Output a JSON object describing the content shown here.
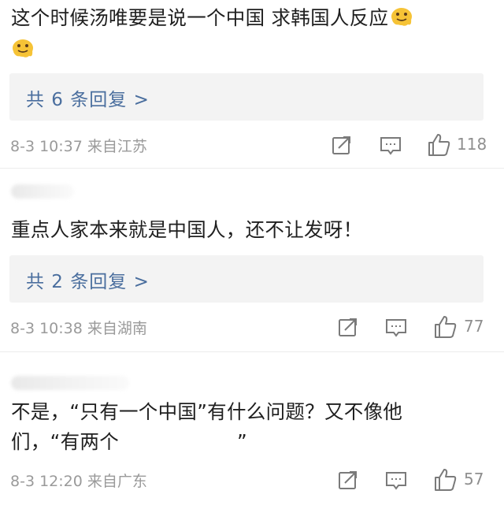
{
  "comments": [
    {
      "text": "这个时候汤唯要是说一个中国 求韩国人反应",
      "emoji_icon": "melting-face-emoji",
      "replies_label": "共 6 条回复 >",
      "meta": "8-3 10:37  来自江苏",
      "likes": "118"
    },
    {
      "text": "重点人家本来就是中国人，还不让发呀！",
      "replies_label": "共 2 条回复 >",
      "meta": "8-3 10:38  来自湖南",
      "likes": "77"
    },
    {
      "text_line1": "不是，“只有一个中国”有什么问题？又不像他",
      "text_line2_start": "们，“有两个",
      "text_line2_end": "”",
      "meta": "8-3 12:20  来自广东",
      "likes": "57"
    }
  ],
  "icons": {
    "repost": "repost-icon",
    "comment": "comment-icon",
    "like": "thumbs-up-icon"
  },
  "colors": {
    "link": "#4a6e9e",
    "meta": "#9a9a9a",
    "reply_bg": "#f3f3f3",
    "icon": "#7a7a7a"
  }
}
